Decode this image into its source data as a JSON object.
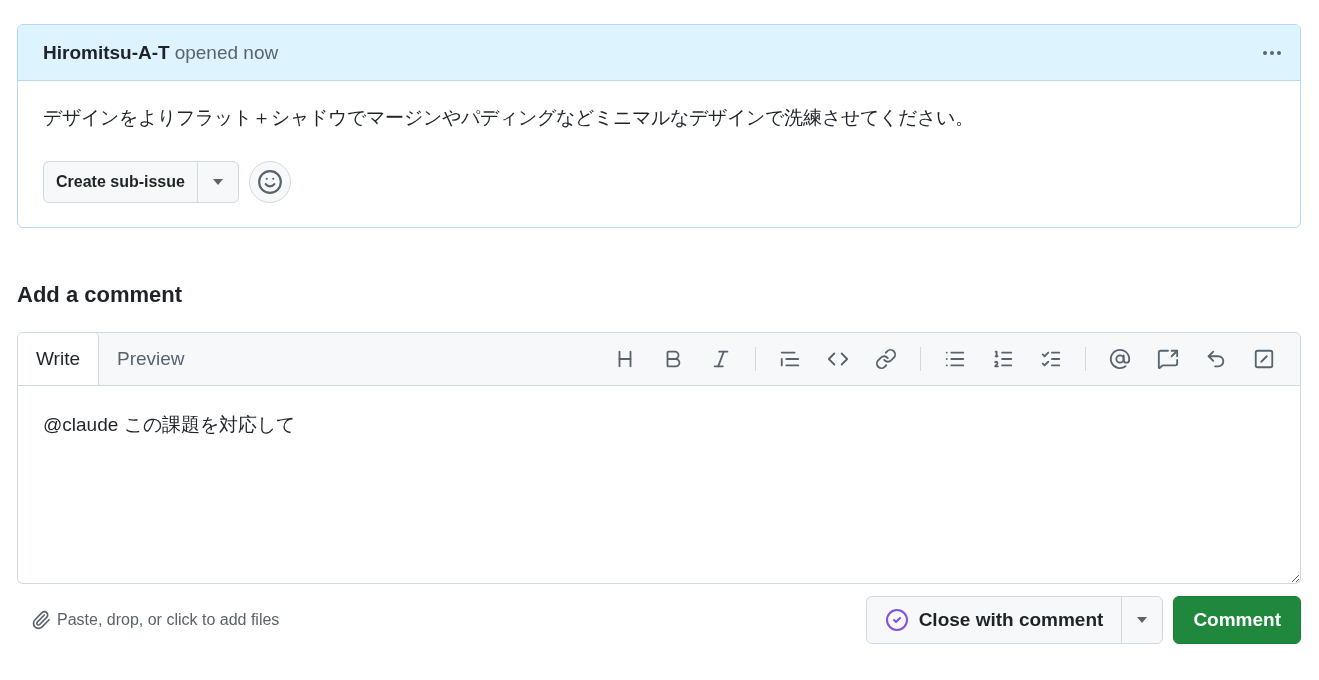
{
  "issue": {
    "author": "Hiromitsu-A-T",
    "status": "opened now",
    "body": "デザインをよりフラット＋シャドウでマージンやパディングなどミニマルなデザインで洗練させてください。",
    "sub_issue_button": "Create sub-issue"
  },
  "comment_heading": "Add a comment",
  "editor": {
    "tabs": [
      {
        "label": "Write",
        "selected": true
      },
      {
        "label": "Preview",
        "selected": false
      }
    ],
    "value": "@claude この課題を対応して",
    "attach_hint": "Paste, drop, or click to add files"
  },
  "actions": {
    "close_button": "Close with comment",
    "comment_button": "Comment"
  }
}
